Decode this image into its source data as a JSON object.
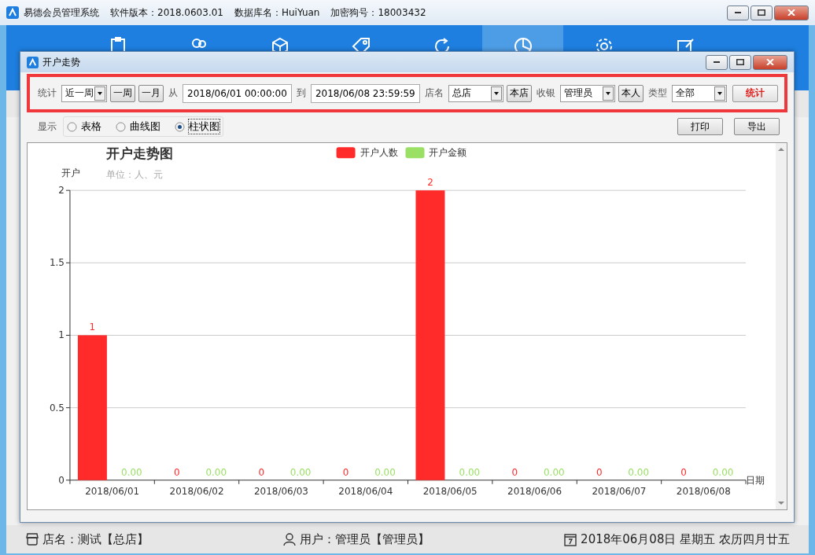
{
  "window": {
    "title": "易德会员管理系统",
    "info": [
      "软件版本：2018.0603.01",
      "数据库名：HuiYuan",
      "加密狗号：18003432"
    ]
  },
  "nav_items": [
    {
      "selected": false
    },
    {
      "selected": false
    },
    {
      "selected": false
    },
    {
      "selected": false
    },
    {
      "selected": false
    },
    {
      "selected": true
    },
    {
      "selected": false
    },
    {
      "selected": false
    }
  ],
  "dialog": {
    "title": "开户走势",
    "filters": [
      {
        "kind": "label",
        "text": "统计"
      },
      {
        "kind": "select",
        "text": "近一周"
      },
      {
        "kind": "button",
        "text": "一周"
      },
      {
        "kind": "button",
        "text": "一月"
      },
      {
        "kind": "label",
        "text": "从"
      },
      {
        "kind": "input",
        "text": "2018/06/01 00:00:00"
      },
      {
        "kind": "label",
        "text": "到"
      },
      {
        "kind": "input",
        "text": "2018/06/08 23:59:59"
      },
      {
        "kind": "label",
        "text": "店名"
      },
      {
        "kind": "select",
        "text": "总店"
      },
      {
        "kind": "button",
        "text": "本店"
      },
      {
        "kind": "label",
        "text": "收银"
      },
      {
        "kind": "select",
        "text": "管理员"
      },
      {
        "kind": "button",
        "text": "本人"
      },
      {
        "kind": "label",
        "text": "类型"
      },
      {
        "kind": "select",
        "text": "全部"
      },
      {
        "kind": "primary",
        "text": "统计"
      }
    ],
    "display": {
      "label": "显示",
      "options": [
        {
          "label": "表格",
          "selected": false
        },
        {
          "label": "曲线图",
          "selected": false
        },
        {
          "label": "柱状图",
          "selected": true
        }
      ]
    },
    "actions": [
      "打印",
      "导出"
    ],
    "chart": {
      "subtitle": "单位：人、元",
      "chart_data": {
        "type": "bar",
        "title": "开户走势图",
        "xlabel": "日期",
        "ylabel": "开户",
        "categories": [
          "2018/06/01",
          "2018/06/02",
          "2018/06/03",
          "2018/06/04",
          "2018/06/05",
          "2018/06/06",
          "2018/06/07",
          "2018/06/08"
        ],
        "series": [
          {
            "name": "开户人数",
            "color": "#ff2a2a",
            "values": [
              1,
              0,
              0,
              0,
              2,
              0,
              0,
              0
            ]
          },
          {
            "name": "开户金额",
            "color": "#99e064",
            "values": [
              0,
              0,
              0,
              0,
              0,
              0,
              0,
              0
            ]
          }
        ],
        "ylim": [
          0,
          2
        ],
        "grid": true,
        "yticks": [
          0,
          0.5,
          1,
          1.5,
          2
        ],
        "value_labels": [
          [
            "1",
            "0",
            "0",
            "0",
            "2",
            "0",
            "0",
            "0"
          ],
          [
            "0.00",
            "0.00",
            "0.00",
            "0.00",
            "0.00",
            "0.00",
            "0.00",
            "0.00"
          ]
        ]
      }
    }
  },
  "status_bar": [
    {
      "text": "店名：测试【总店】"
    },
    {
      "text": "用户：管理员【管理员】"
    },
    {
      "text": "2018年06月08日 星期五 农历四月廿五"
    }
  ]
}
